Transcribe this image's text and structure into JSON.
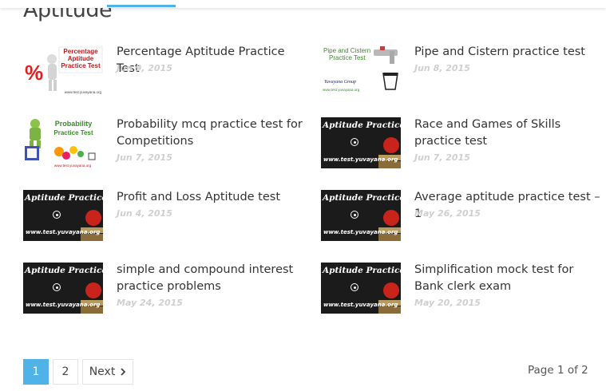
{
  "category": {
    "title": "Aptitude"
  },
  "posts": [
    {
      "title": "Percentage Aptitude Practice Test",
      "date": "Jun 9, 2015",
      "thumb_text": [
        "Percentage",
        "Aptitude",
        "Practice Test"
      ],
      "thumb_site": "www.test.yuvayana.org"
    },
    {
      "title": "Pipe and Cistern practice test",
      "date": "Jun 8, 2015",
      "thumb_text": [
        "Pipe and Cistern",
        "Practice Test"
      ],
      "thumb_brand": "Yuvayana Group",
      "thumb_site": "www.test.yuvayana.org"
    },
    {
      "title": "Probability mcq practice test for Competitions",
      "date": "Jun 7, 2015",
      "thumb_text": [
        "Probability",
        "Practice Test"
      ],
      "thumb_site": "www.test.yuvayana.org"
    },
    {
      "title": "Race and Games of Skills practice test",
      "date": "Jun 7, 2015",
      "thumb_text": [
        "Aptitude Practice Test"
      ],
      "thumb_site": "www.test.yuvayana.org"
    },
    {
      "title": "Profit and Loss Aptitude test",
      "date": "Jun 4, 2015",
      "thumb_text": [
        "Aptitude Practice Test"
      ],
      "thumb_site": "www.test.yuvayana.org"
    },
    {
      "title": "Average aptitude practice test – 1",
      "date": "May 26, 2015",
      "thumb_text": [
        "Aptitude Practice Test"
      ],
      "thumb_site": "www.test.yuvayana.org"
    },
    {
      "title": "simple and compound interest practice problems",
      "date": "May 24, 2015",
      "thumb_text": [
        "Aptitude Practice Test"
      ],
      "thumb_site": "www.test.yuvayana.org"
    },
    {
      "title": "Simplification mock test for Bank clerk exam",
      "date": "May 20, 2015",
      "thumb_text": [
        "Aptitude Practice Test"
      ],
      "thumb_site": "www.test.yuvayana.org"
    }
  ],
  "pagination": {
    "pages": [
      "1",
      "2"
    ],
    "current": "1",
    "next_label": "Next",
    "next_icon": "chevron-right-icon",
    "page_info": "Page 1 of 2"
  },
  "colors": {
    "accent": "#4fb3e8"
  }
}
